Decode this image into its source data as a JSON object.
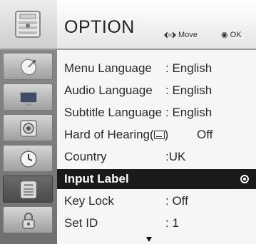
{
  "header": {
    "title": "OPTION",
    "move_hint": "Move",
    "ok_hint": "OK"
  },
  "sidebar": {
    "items": [
      {
        "icon": "satellite-dish-icon"
      },
      {
        "icon": "tv-screen-icon"
      },
      {
        "icon": "speaker-icon"
      },
      {
        "icon": "clock-icon"
      },
      {
        "icon": "option-panel-icon",
        "selected": true
      },
      {
        "icon": "lock-icon"
      }
    ]
  },
  "menu": {
    "items": [
      {
        "label": "Menu Language",
        "value": ": English"
      },
      {
        "label": "Audio Language",
        "value": ": English"
      },
      {
        "label": "Subtitle Language",
        "value": ": English"
      },
      {
        "label": "Hard of Hearing(",
        "value": "Off"
      },
      {
        "label": "Country",
        "value": ":UK"
      },
      {
        "label": "Input Label",
        "value": "",
        "selected": true
      },
      {
        "label": "Key Lock",
        "value": ": Off"
      },
      {
        "label": "Set ID",
        "value": ": 1"
      }
    ]
  }
}
